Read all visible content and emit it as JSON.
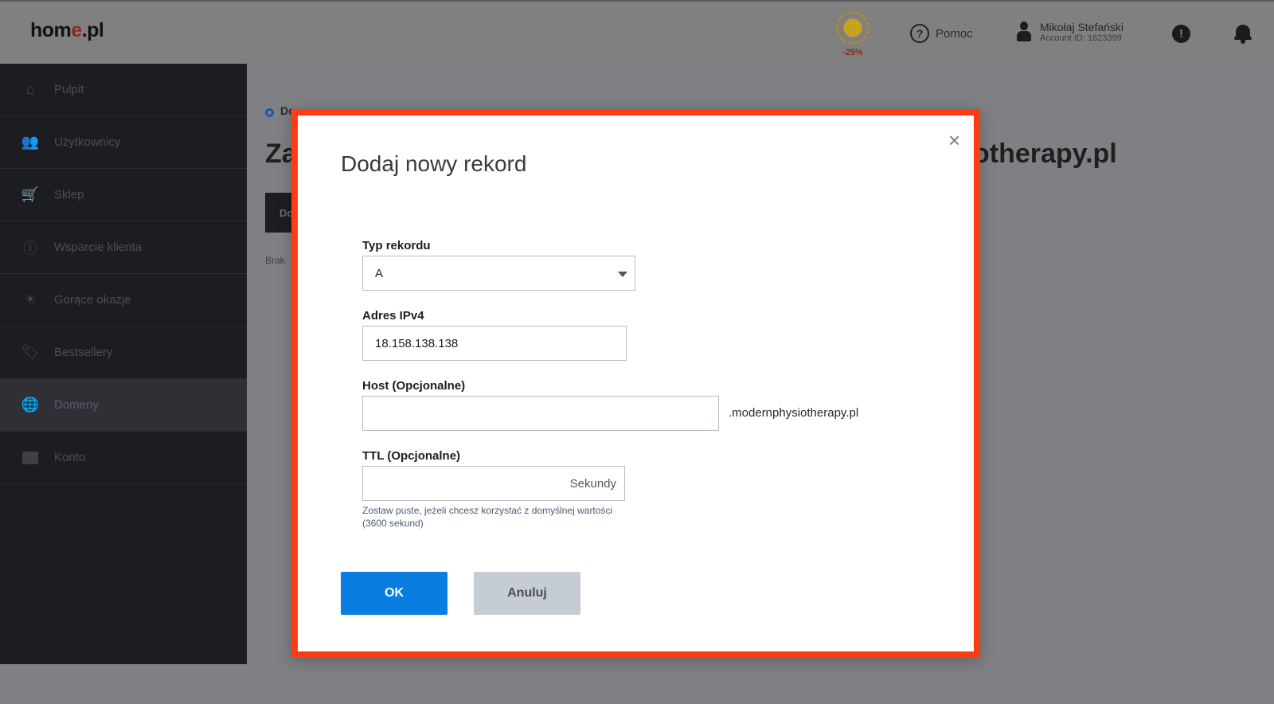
{
  "topbar": {
    "logo_prefix": "hom",
    "logo_accent": "e",
    "logo_suffix": ".pl",
    "promo_badge": "-25%",
    "help_label": "Pomoc",
    "user_name": "Mikołaj Stefański",
    "account_id": "Account ID: 1623399"
  },
  "sidebar": {
    "items": [
      {
        "label": "Pulpit",
        "icon": "home-icon"
      },
      {
        "label": "Użytkownicy",
        "icon": "users-icon"
      },
      {
        "label": "Sklep",
        "icon": "cart-icon"
      },
      {
        "label": "Wsparcie klienta",
        "icon": "info-icon"
      },
      {
        "label": "Gorące okazje",
        "icon": "sun-icon"
      },
      {
        "label": "Bestsellery",
        "icon": "tag-icon"
      },
      {
        "label": "Domeny",
        "icon": "globe-icon",
        "active": true
      },
      {
        "label": "Konto",
        "icon": "briefcase-icon"
      }
    ]
  },
  "background": {
    "breadcrumb": "Do",
    "title_left": "Za",
    "title_right": "otherapy.pl",
    "button_fragment": "Do",
    "small_text": "Brak"
  },
  "modal": {
    "title": "Dodaj nowy rekord",
    "close_symbol": "×",
    "record_type_label": "Typ rekordu",
    "record_type_value": "A",
    "ipv4_label": "Adres IPv4",
    "ipv4_value": "18.158.138.138",
    "host_label": "Host (Opcjonalne)",
    "host_value": "",
    "host_suffix": ".modernphysiotherapy.pl",
    "ttl_label": "TTL (Opcjonalne)",
    "ttl_value": "",
    "ttl_unit": "Sekundy",
    "ttl_hint": "Zostaw puste, jeżeli chcesz korzystać z domyślnej wartości (3600 sekund)",
    "ok_label": "OK",
    "cancel_label": "Anuluj"
  },
  "colors": {
    "modal_border": "#ff3b14",
    "primary_button": "#0a7de0",
    "secondary_button": "#c6ccd4"
  }
}
